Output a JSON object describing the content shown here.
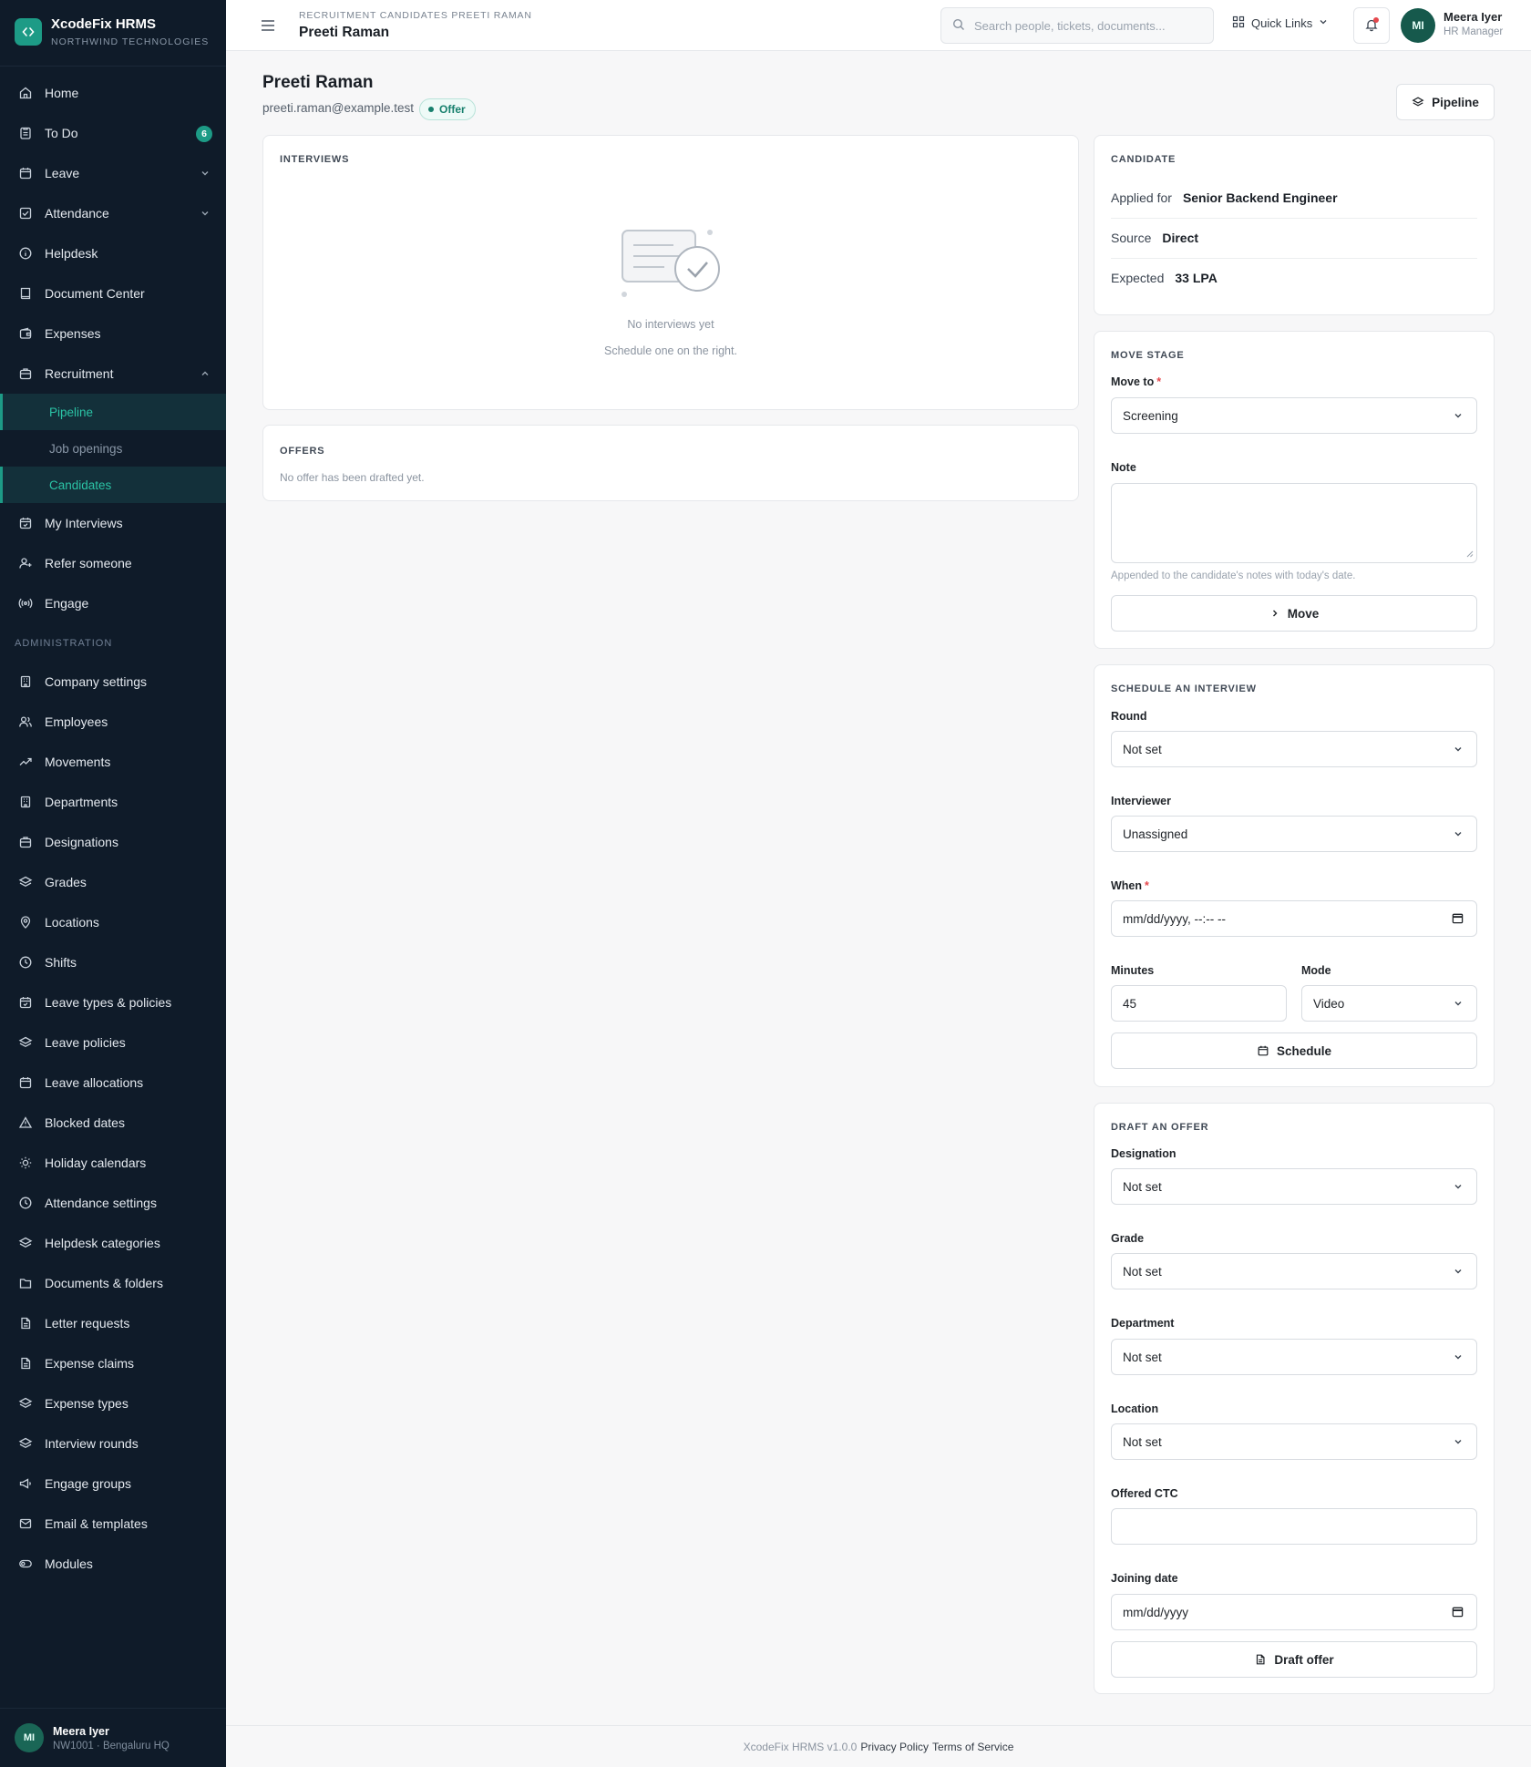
{
  "brand": {
    "name": "XcodeFix HRMS",
    "org": "NORTHWIND TECHNOLOGIES"
  },
  "nav": {
    "home": "Home",
    "todo": "To Do",
    "todo_badge": "6",
    "leave": "Leave",
    "attendance": "Attendance",
    "helpdesk": "Helpdesk",
    "document_center": "Document Center",
    "expenses": "Expenses",
    "recruitment": "Recruitment",
    "recruitment_sub": [
      "Pipeline",
      "Job openings",
      "Candidates"
    ],
    "my_interviews": "My Interviews",
    "refer": "Refer someone",
    "engage": "Engage",
    "admin_label": "ADMINISTRATION",
    "admin": [
      "Company settings",
      "Employees",
      "Movements",
      "Departments",
      "Designations",
      "Grades",
      "Locations",
      "Shifts",
      "Leave types & policies",
      "Leave policies",
      "Leave allocations",
      "Blocked dates",
      "Holiday calendars",
      "Attendance settings",
      "Helpdesk categories",
      "Documents & folders",
      "Letter requests",
      "Expense claims",
      "Expense types",
      "Interview rounds",
      "Engage groups",
      "Email & templates",
      "Modules"
    ]
  },
  "sidebar_user": {
    "initials": "MI",
    "name": "Meera Iyer",
    "meta": "NW1001 · Bengaluru HQ"
  },
  "topbar": {
    "breadcrumb": "RECRUITMENT CANDIDATES PREETI RAMAN",
    "title": "Preeti Raman",
    "search_placeholder": "Search people, tickets, documents...",
    "quick_links": "Quick Links",
    "user_initials": "MI",
    "user_name": "Meera Iyer",
    "user_role": "HR Manager"
  },
  "candidate": {
    "name": "Preeti Raman",
    "email": "preeti.raman@example.test",
    "status": "Offer",
    "pipeline_button": "Pipeline"
  },
  "interviews": {
    "label": "INTERVIEWS",
    "empty_title": "No interviews yet",
    "empty_sub": "Schedule one on the right."
  },
  "offers": {
    "label": "OFFERS",
    "empty": "No offer has been drafted yet."
  },
  "candidate_card": {
    "label": "CANDIDATE",
    "applied_for_key": "Applied for",
    "applied_for": "Senior Backend Engineer",
    "source_key": "Source",
    "source": "Direct",
    "expected_key": "Expected",
    "expected": "33 LPA"
  },
  "move_stage": {
    "label": "MOVE STAGE",
    "move_to_label": "Move to",
    "move_to_value": "Screening",
    "note_label": "Note",
    "note_value": "",
    "help": "Appended to the candidate's notes with today's date.",
    "button": "Move"
  },
  "schedule": {
    "label": "SCHEDULE AN INTERVIEW",
    "round_label": "Round",
    "round_value": "Not set",
    "interviewer_label": "Interviewer",
    "interviewer_value": "Unassigned",
    "when_label": "When",
    "when_placeholder": "mm/dd/yyyy, --:-- --",
    "minutes_label": "Minutes",
    "minutes_value": "45",
    "mode_label": "Mode",
    "mode_value": "Video",
    "button": "Schedule"
  },
  "offer_form": {
    "label": "DRAFT AN OFFER",
    "designation_label": "Designation",
    "designation_value": "Not set",
    "grade_label": "Grade",
    "grade_value": "Not set",
    "department_label": "Department",
    "department_value": "Not set",
    "location_label": "Location",
    "location_value": "Not set",
    "ctc_label": "Offered CTC",
    "ctc_value": "",
    "joining_label": "Joining date",
    "joining_placeholder": "mm/dd/yyyy",
    "button": "Draft offer"
  },
  "footer": {
    "version": "XcodeFix HRMS v1.0.0",
    "privacy": "Privacy Policy",
    "terms": "Terms of Service"
  }
}
